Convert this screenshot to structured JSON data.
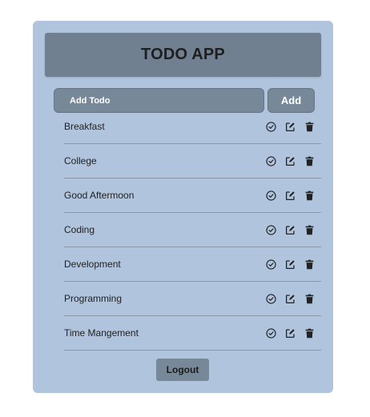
{
  "app": {
    "title": "TODO APP"
  },
  "add_form": {
    "placeholder": "Add Todo",
    "button_label": "Add"
  },
  "todos": [
    {
      "text": "Breakfast"
    },
    {
      "text": "College"
    },
    {
      "text": "Good Aftermoon"
    },
    {
      "text": "Coding"
    },
    {
      "text": "Development"
    },
    {
      "text": "Programming"
    },
    {
      "text": "Time Mangement"
    }
  ],
  "icons": {
    "complete": "check-circle-icon",
    "edit": "edit-icon",
    "delete": "trash-icon"
  },
  "footer": {
    "logout_label": "Logout"
  },
  "colors": {
    "card_background": "#b0c4de",
    "header_background": "#708090",
    "control_background": "#778899"
  }
}
